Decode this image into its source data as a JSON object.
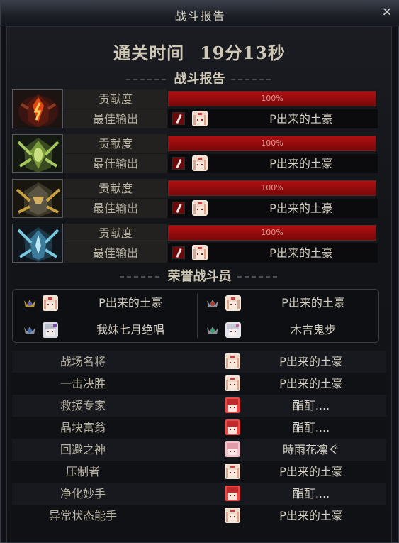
{
  "window": {
    "title": "战斗报告",
    "close_label": "×"
  },
  "clear_time": {
    "label": "通关时间",
    "value": "19分13秒"
  },
  "report_header": "战斗报告",
  "bosses": [
    {
      "icon": "boss-red-icon",
      "contribution_label": "贡献度",
      "contribution": 100,
      "contribution_text": "100%",
      "best_label": "最佳输出",
      "best_name": "P出来的土豪"
    },
    {
      "icon": "boss-green-icon",
      "contribution_label": "贡献度",
      "contribution": 100,
      "contribution_text": "100%",
      "best_label": "最佳输出",
      "best_name": "P出来的土豪"
    },
    {
      "icon": "boss-gold-icon",
      "contribution_label": "贡献度",
      "contribution": 100,
      "contribution_text": "100%",
      "best_label": "最佳输出",
      "best_name": "P出来的土豪"
    },
    {
      "icon": "boss-blue-icon",
      "contribution_label": "贡献度",
      "contribution": 100,
      "contribution_text": "100%",
      "best_label": "最佳输出",
      "best_name": "P出来的土豪"
    }
  ],
  "honor_header": "荣誉战斗员",
  "honor": [
    {
      "name": "P出来的土豪"
    },
    {
      "name": "P出来的土豪"
    },
    {
      "name": "我妹七月绝唱"
    },
    {
      "name": "木吉鬼步"
    }
  ],
  "awards": [
    {
      "title": "战场名将",
      "name": "P出来的土豪"
    },
    {
      "title": "一击决胜",
      "name": "P出来的土豪"
    },
    {
      "title": "救援专家",
      "name": "酯酊...."
    },
    {
      "title": "晶块富翁",
      "name": "酯酊...."
    },
    {
      "title": "回避之神",
      "name": "時雨花凛ぐ"
    },
    {
      "title": "压制者",
      "name": "P出来的土豪"
    },
    {
      "title": "净化妙手",
      "name": "酯酊...."
    },
    {
      "title": "异常状态能手",
      "name": "P出来的土豪"
    }
  ],
  "colors": {
    "bar_fill": "#b01012",
    "accent_text": "#cfc8b6"
  }
}
